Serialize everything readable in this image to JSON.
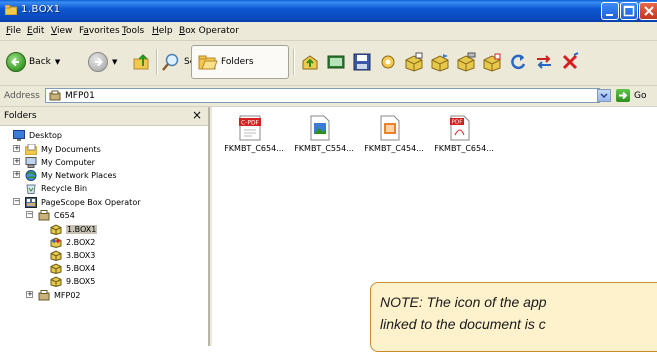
{
  "window": {
    "title": "1.BOX1"
  },
  "menu": [
    "File",
    "Edit",
    "View",
    "Favorites",
    "Tools",
    "Help",
    "Box Operator"
  ],
  "menu_underline": [
    "F",
    "E",
    "V",
    "a",
    "T",
    "H",
    "B"
  ],
  "toolbar": {
    "back_label": "Back",
    "search_label": "Search",
    "folders_label": "Folders",
    "tool_icons": [
      "folder-up-icon",
      "box-icon",
      "scan-icon",
      "save-icon",
      "settings-icon",
      "box-copy-icon",
      "box-move-icon",
      "box-delete-icon",
      "box-print-icon",
      "refresh-icon",
      "swap-icon",
      "delete-x-icon"
    ]
  },
  "address": {
    "label": "Address",
    "value": "MFP01",
    "go_label": "Go"
  },
  "folders": {
    "title": "Folders",
    "close": "×",
    "tree": [
      {
        "label": "Desktop",
        "icon": "desktop-icon",
        "level": 0,
        "expander": ""
      },
      {
        "label": "My Documents",
        "icon": "my-documents-icon",
        "level": 1,
        "expander": "+"
      },
      {
        "label": "My Computer",
        "icon": "my-computer-icon",
        "level": 1,
        "expander": "+"
      },
      {
        "label": "My Network Places",
        "icon": "network-places-icon",
        "level": 1,
        "expander": "+"
      },
      {
        "label": "Recycle Bin",
        "icon": "recycle-bin-icon",
        "level": 1,
        "expander": ""
      },
      {
        "label": "PageScope Box Operator",
        "icon": "box-operator-icon",
        "level": 1,
        "expander": "−"
      },
      {
        "label": "C654",
        "icon": "mfp-icon",
        "level": 2,
        "expander": "−"
      },
      {
        "label": "1.BOX1",
        "icon": "box-icon",
        "level": 3,
        "expander": "",
        "selected": true
      },
      {
        "label": "2.BOX2",
        "icon": "box-people-icon",
        "level": 3,
        "expander": ""
      },
      {
        "label": "3.BOX3",
        "icon": "box-icon",
        "level": 3,
        "expander": ""
      },
      {
        "label": "5.BOX4",
        "icon": "box-icon",
        "level": 3,
        "expander": ""
      },
      {
        "label": "9.BOX5",
        "icon": "box-icon",
        "level": 3,
        "expander": ""
      },
      {
        "label": "MFP02",
        "icon": "mfp-icon",
        "level": 2,
        "expander": "+"
      }
    ]
  },
  "files": [
    {
      "name": "FKMBT_C654...",
      "icon": "compact-pdf-icon",
      "badge": "C-PDF"
    },
    {
      "name": "FKMBT_C554...",
      "icon": "image-file-icon",
      "badge": ""
    },
    {
      "name": "FKMBT_C454...",
      "icon": "office-file-icon",
      "badge": ""
    },
    {
      "name": "FKMBT_C654...",
      "icon": "pdf-file-icon",
      "badge": "PDF"
    }
  ],
  "note": {
    "line1": "NOTE: The icon of the app",
    "line2": "linked to the document is c"
  },
  "colors": {
    "titlebar": "#0a5fd8",
    "note_bg": "#fdf2cc",
    "note_border": "#c98b2e",
    "pdf_red": "#d42020"
  }
}
